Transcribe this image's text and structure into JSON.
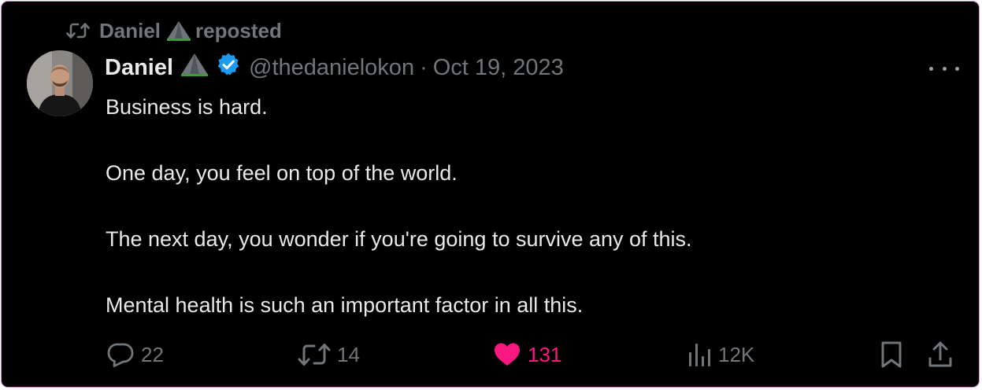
{
  "repost": {
    "user": "Daniel",
    "label": "reposted"
  },
  "tweet": {
    "name": "Daniel",
    "handle": "@thedanielokon",
    "separator": "·",
    "date": "Oct 19, 2023",
    "lines": [
      "Business is hard.",
      "One day, you feel on top of the world.",
      "The next day, you wonder if you're going to survive any of this.",
      "Mental health is such an important factor in all this."
    ]
  },
  "actions": {
    "replies": "22",
    "reposts": "14",
    "likes": "131",
    "views": "12K"
  },
  "icons": {
    "repost_header": "repost-icon",
    "badge": "mountain-emoji-icon",
    "verified": "verified-badge-icon",
    "more": "more-icon",
    "reply": "reply-icon",
    "repost": "repost-icon",
    "like": "heart-icon",
    "views": "views-icon",
    "bookmark": "bookmark-icon",
    "share": "share-icon"
  },
  "colors": {
    "background": "#000000",
    "text_primary": "#e7e9ea",
    "text_secondary": "#71767b",
    "like_active": "#f91880",
    "verified": "#1d9bf0",
    "card_border": "#d98fd6"
  }
}
